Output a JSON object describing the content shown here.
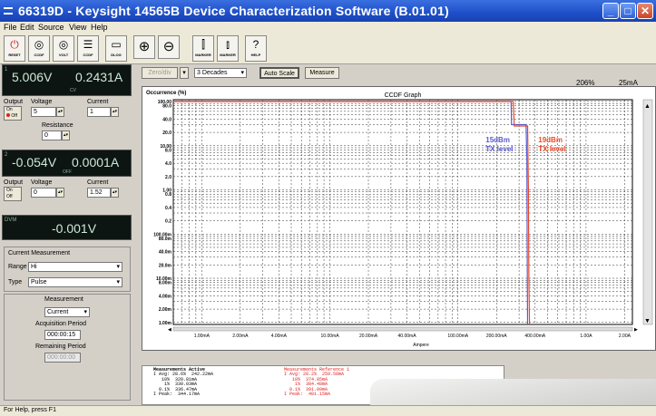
{
  "window": {
    "title": "66319D - Keysight 14565B Device Characterization Software (B.01.01)"
  },
  "menu": [
    "File",
    "Edit",
    "Source",
    "View",
    "Help"
  ],
  "toolbar": {
    "buttons": [
      {
        "label": "RESET",
        "icon": "power-icon",
        "glyph": "⏻"
      },
      {
        "label": "CCDF",
        "icon": "ccdf-icon",
        "glyph": "◎"
      },
      {
        "label": "VOLT",
        "icon": "volt-icon",
        "glyph": "◎"
      },
      {
        "label": "CCDF",
        "icon": "ccdf-list-icon",
        "glyph": "☰"
      },
      {
        "label": "DLOG",
        "icon": "dlog-icon",
        "glyph": "▭"
      },
      {
        "label": "",
        "icon": "zoom-in-icon",
        "glyph": "⊕"
      },
      {
        "label": "",
        "icon": "zoom-out-icon",
        "glyph": "⊖"
      },
      {
        "label": "MARKER",
        "icon": "marker-icon",
        "glyph": "⫿"
      },
      {
        "label": "MARKER",
        "icon": "marker-clear-icon",
        "glyph": "⫾"
      },
      {
        "label": "HELP",
        "icon": "help-icon",
        "glyph": "?"
      }
    ]
  },
  "channel1": {
    "number": "1",
    "voltage": "5.006V",
    "current": "0.2431A",
    "mode": "CV",
    "output_label": "Output",
    "voltage_label": "Voltage",
    "current_label": "Current",
    "on": "On",
    "off": "Off",
    "voltage_set": "5",
    "current_set": "1",
    "resistance_label": "Resistance",
    "resistance_set": "0"
  },
  "channel2": {
    "number": "2",
    "voltage": "-0.054V",
    "current": "0.0001A",
    "mode": "OFF",
    "output_label": "Output",
    "voltage_label": "Voltage",
    "current_label": "Current",
    "on": "On",
    "off": "Off",
    "voltage_set": "0",
    "current_set": "1.52"
  },
  "dvm": {
    "label": "DVM",
    "value": "-0.001V"
  },
  "current_measurement": {
    "title": "Current Measurement",
    "range_label": "Range",
    "range_value": "Hi",
    "type_label": "Type",
    "type_value": "Pulse"
  },
  "measurement": {
    "title": "Measurement",
    "value": "Current",
    "acq_label": "Acquisition Period",
    "acq_value": "000:00:15",
    "rem_label": "Remaining Period",
    "rem_value": "000:00:00"
  },
  "graph_controls": {
    "zero_div": "Zero/div",
    "decades": "3 Decades",
    "auto_scale": "Auto Scale",
    "measure": "Measure",
    "readout_pct": "206%",
    "readout_current": "25mA"
  },
  "chart_data": {
    "type": "line",
    "title": "CCDF Graph",
    "ylabel": "Occurrence (%)",
    "xlabel": "Ampere",
    "x_tick_labels": [
      "1.00mA",
      "2.00mA",
      "4.00mA",
      "10.00mA",
      "20.00mA",
      "40.00mA",
      "100.00mA",
      "200.00mA",
      "400.00mA",
      "1.00A",
      "2.00A"
    ],
    "x_ticks": [
      1,
      2,
      4,
      10,
      20,
      40,
      100,
      200,
      400,
      1000,
      2000
    ],
    "xlim": [
      0.6,
      2300
    ],
    "y_tick_labels": [
      "100.00",
      "80.0",
      "40.0",
      "20.0",
      "10.00",
      "8.0",
      "4.0",
      "2.0",
      "1.00",
      "0.8",
      "0.4",
      "0.2",
      "100.00m",
      "80.0m",
      "40.0m",
      "20.0m",
      "10.00m",
      "8.00m",
      "4.00m",
      "2.00m",
      "1.00m"
    ],
    "y_ticks": [
      100,
      80,
      40,
      20,
      10,
      8,
      4,
      2,
      1,
      0.8,
      0.4,
      0.2,
      0.1,
      0.08,
      0.04,
      0.02,
      0.01,
      0.008,
      0.004,
      0.002,
      0.001
    ],
    "ylim": [
      0.0009,
      110
    ],
    "log_x": true,
    "log_y": true,
    "grid": true,
    "series": [
      {
        "name": "15dBm TX level",
        "color": "#5a5ad0",
        "x": [
          0.6,
          260,
          262,
          340,
          345,
          348,
          350
        ],
        "y": [
          100,
          100,
          30,
          30,
          5,
          0.01,
          0.0009
        ]
      },
      {
        "name": "19dBm TX level",
        "color": "#e84a2a",
        "x": [
          0.6,
          270,
          275,
          350,
          355,
          358,
          362
        ],
        "y": [
          100,
          100,
          28,
          28,
          1,
          0.01,
          0.0009
        ]
      }
    ],
    "annotations": [
      {
        "text": "15dBm",
        "color": "#5a5ad0"
      },
      {
        "text": "TX level",
        "color": "#5a5ad0"
      },
      {
        "text": "19dBm",
        "color": "#e84a2a"
      },
      {
        "text": "TX level",
        "color": "#e84a2a"
      }
    ]
  },
  "measurements_active": {
    "title": "Measurements Active",
    "lines": [
      "I Avg: 28.6%  242.22mA",
      "   10%  320.81mA",
      "    1%  330.03mA",
      "  0.1%  336.47mA",
      "I Peak:  344.17mA"
    ]
  },
  "measurements_reference": {
    "title": "Measurements Reference 1",
    "lines": [
      "I Avg: 28.2%  259.58mA",
      "   10%  374.85mA",
      "    1%  384.48mA",
      "  0.1%  391.09mA",
      "I Peak:  401.15mA"
    ]
  },
  "status": {
    "text": "For Help, press F1"
  },
  "colors": {
    "titlebar": "#1e4fc8",
    "display_bg": "#0c1512",
    "ref_trace": "#e84a2a",
    "active_trace": "#5a5ad0"
  }
}
